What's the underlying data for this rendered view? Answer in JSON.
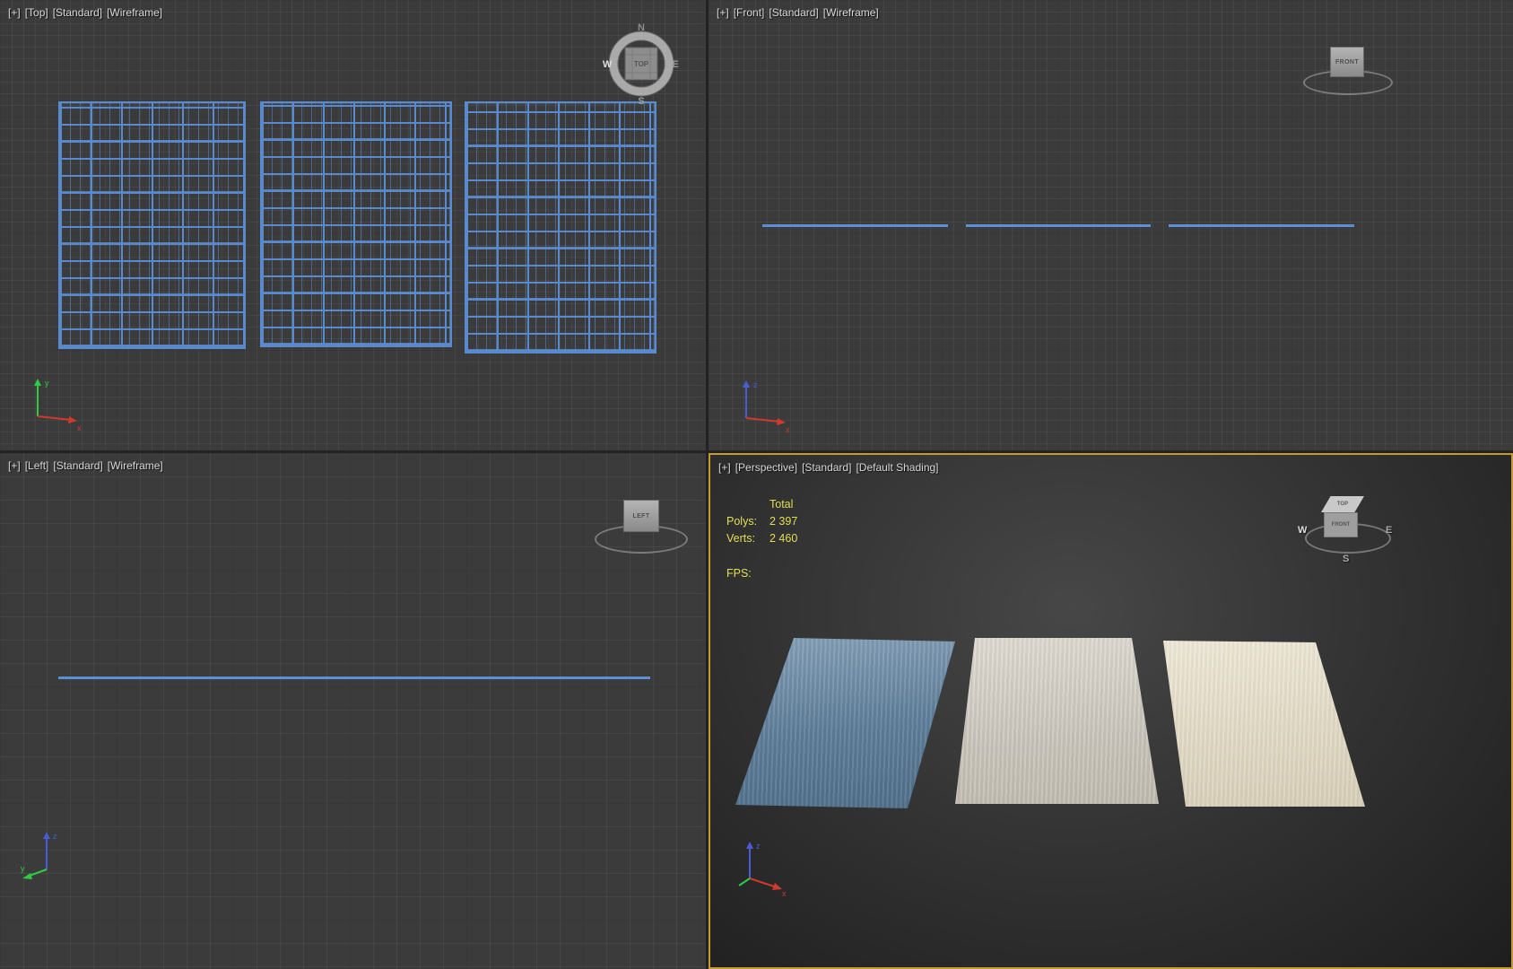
{
  "viewports": {
    "top": {
      "tokens": [
        "[+]",
        "[Top]",
        "[Standard]",
        "[Wireframe]"
      ]
    },
    "front": {
      "tokens": [
        "[+]",
        "[Front]",
        "[Standard]",
        "[Wireframe]"
      ]
    },
    "left": {
      "tokens": [
        "[+]",
        "[Left]",
        "[Standard]",
        "[Wireframe]"
      ]
    },
    "perspective": {
      "tokens": [
        "[+]",
        "[Perspective]",
        "[Standard]",
        "[Default Shading]"
      ]
    }
  },
  "stats": {
    "total_label": "Total",
    "polys_label": "Polys:",
    "polys_value": "2 397",
    "verts_label": "Verts:",
    "verts_value": "2 460",
    "fps_label": "FPS:"
  },
  "viewcube": {
    "top_face": "TOP",
    "front_face": "FRONT",
    "left_face": "LEFT",
    "n": "N",
    "s": "S",
    "e": "E",
    "w": "W"
  },
  "axes": {
    "x": "x",
    "y": "y",
    "z": "z"
  },
  "colors": {
    "wire": "#5b8fd6",
    "active": "#c59a2f",
    "stats": "#e3de56",
    "rugBlue": "#6f8ea9",
    "rugGray": "#d6d1c7",
    "rugCream": "#eae3d1",
    "viewportBg": "#3b3b3b"
  }
}
